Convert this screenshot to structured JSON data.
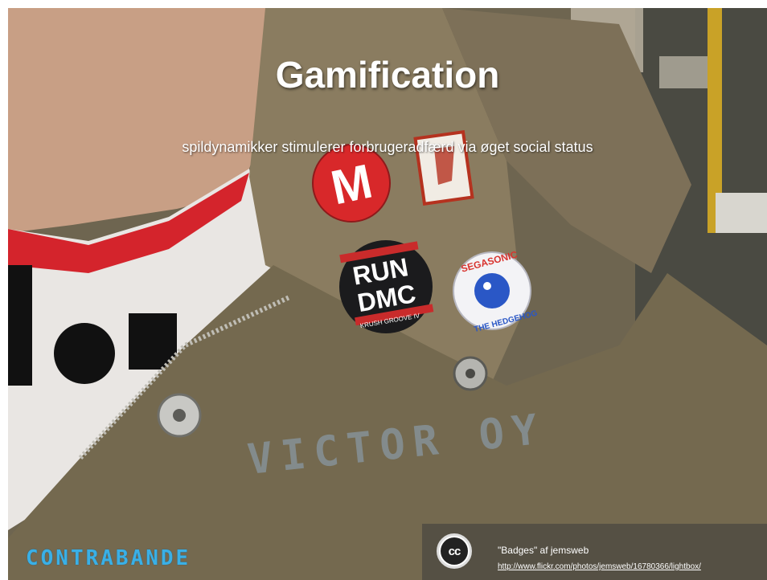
{
  "slide": {
    "title": "Gamification",
    "subtitle": "spildynamikker stimulerer forbrugeradfærd via øget social status"
  },
  "photo": {
    "badges": [
      {
        "id": "m-badge",
        "text": "M"
      },
      {
        "id": "rundmc-badge",
        "line1": "RUN",
        "line2": "DMC",
        "small": "KRUSH GROOVE IV"
      },
      {
        "id": "sega-badge",
        "top": "SEGASONIC",
        "bottom": "THE HEDGEHOG"
      }
    ],
    "jacket_stencil": "VICTOR  OY"
  },
  "logo": {
    "text": "CONTRABANDE"
  },
  "credit": {
    "icon": "cc-icon",
    "icon_text": "cc",
    "text": "\"Badges\" af jemsweb",
    "link": "http://www.flickr.com/photos/jemsweb/16780366/lightbox/"
  },
  "colors": {
    "title": "#ffffff",
    "logo": "#3ab0e6",
    "jacket": "#7a6d55"
  }
}
